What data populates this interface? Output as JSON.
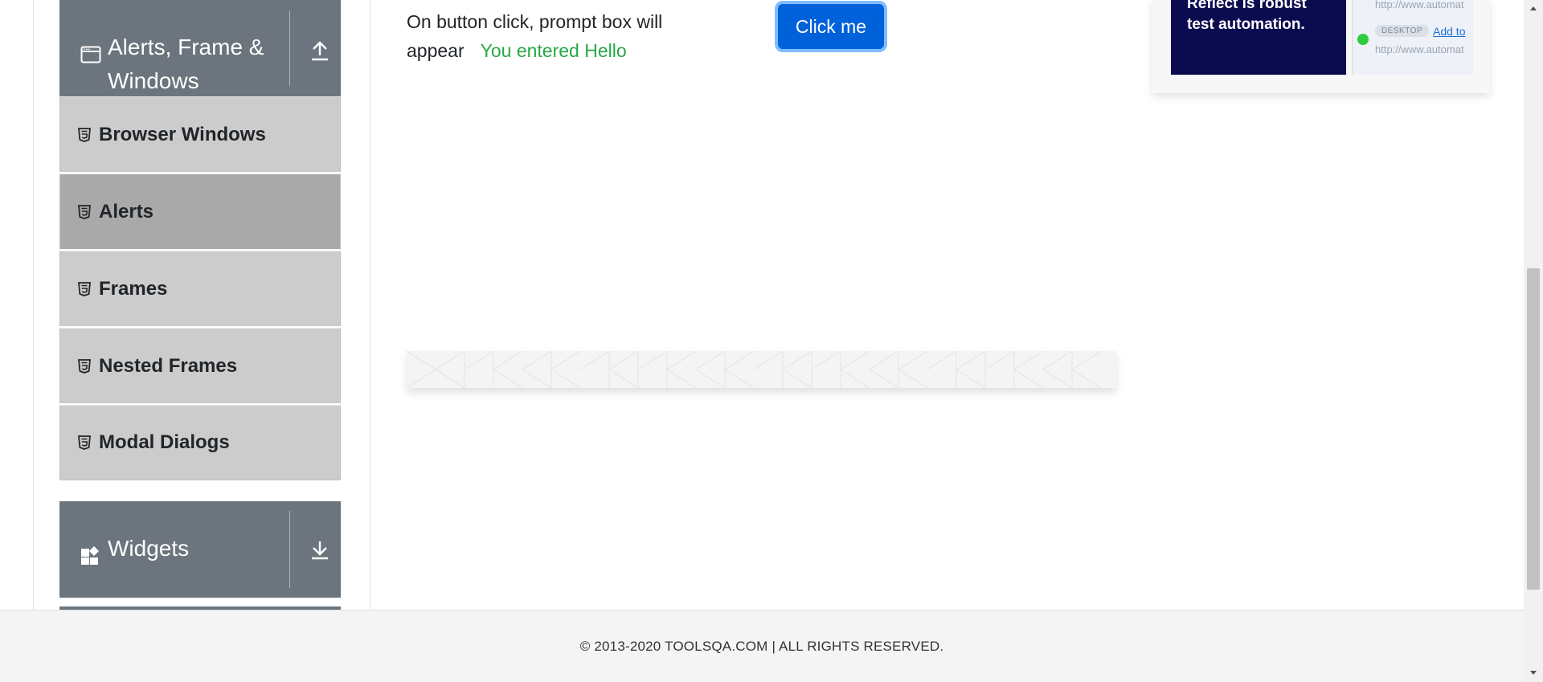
{
  "sidebar": {
    "alerts_group": {
      "title_line1": "Alerts, Frame &",
      "title_line2": "Windows",
      "icon": "window-icon",
      "toggle_icon": "arrow-up-icon"
    },
    "items": [
      {
        "label": "Browser Windows",
        "active": false
      },
      {
        "label": "Alerts",
        "active": true
      },
      {
        "label": "Frames",
        "active": false
      },
      {
        "label": "Nested Frames",
        "active": false
      },
      {
        "label": "Modal Dialogs",
        "active": false
      }
    ],
    "widgets_group": {
      "title": "Widgets",
      "icon": "widgets-icon",
      "toggle_icon": "arrow-down-icon"
    }
  },
  "main": {
    "prompt_text": "On button click, prompt box will appear",
    "prompt_result": "You entered Hello",
    "click_button": "Click me"
  },
  "ad": {
    "headline_line1": "Reflect is robust",
    "headline_line2": "test automation.",
    "url1": "http://www.automat",
    "badge": "DESKTOP",
    "add_to": "Add to",
    "url2": "http://www.automat"
  },
  "footer": {
    "copyright": "© 2013-2020 TOOLSQA.COM | ALL RIGHTS RESERVED."
  },
  "colors": {
    "group_header": "#6c757d",
    "menu_item": "#cccccc",
    "menu_item_active": "#a9a9a9",
    "button_primary": "#0062da",
    "success_text": "#28a745"
  }
}
